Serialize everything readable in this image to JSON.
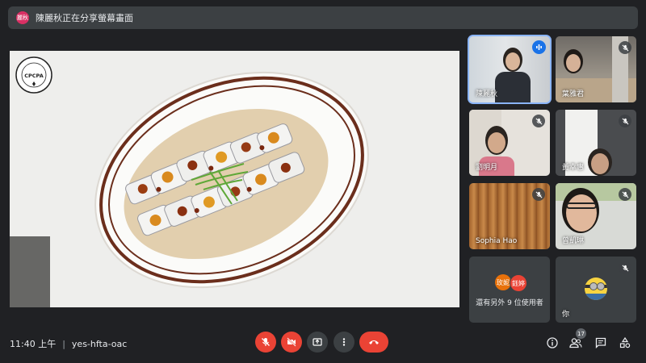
{
  "top": {
    "avatar_text": "麗秋",
    "presenting_text": "陳麗秋正在分享螢幕畫面"
  },
  "share": {
    "logo_text": "CPCPA",
    "logo_ring_text": "中華行子飲供膳業協會"
  },
  "participants": [
    {
      "name": "陳麗秋",
      "mic": "speaking"
    },
    {
      "name": "葉雅君",
      "mic": "muted"
    },
    {
      "name": "劉明月",
      "mic": "muted"
    },
    {
      "name": "黃幸惠",
      "mic": "muted"
    },
    {
      "name": "Sophia Hao",
      "mic": "muted"
    },
    {
      "name": "曾凱琳",
      "mic": "muted"
    }
  ],
  "others": {
    "avatar1": "玫妮",
    "avatar2": "鈺婷",
    "text": "還有另外 9 位使用者"
  },
  "self": {
    "name": "你",
    "mic": "muted"
  },
  "meeting": {
    "time": "11:40 上午",
    "code": "yes-hfta-oac"
  },
  "people_count": "17",
  "colors": {
    "background": "#202124",
    "end_call": "#ea4335",
    "active_border": "#8ab4f8",
    "mic_speaking": "#1a73e8"
  }
}
